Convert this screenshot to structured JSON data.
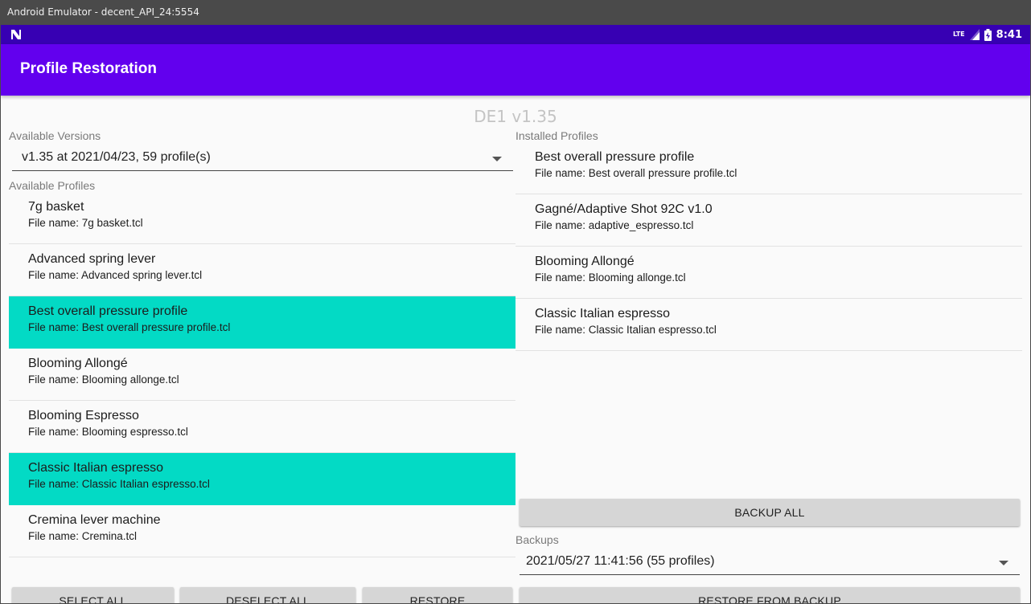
{
  "window": {
    "title": "Android Emulator - decent_API_24:5554"
  },
  "statusbar": {
    "network": "LTE",
    "time": "8:41",
    "icons": [
      "n-notification-icon",
      "signal-icon",
      "battery-charging-icon"
    ]
  },
  "appbar": {
    "title": "Profile Restoration"
  },
  "header": {
    "version": "DE1 v1.35"
  },
  "left": {
    "versions_label": "Available Versions",
    "version_selected": "v1.35 at 2021/04/23, 59 profile(s)",
    "profiles_label": "Available Profiles",
    "profiles": [
      {
        "name": "7g basket",
        "file": "File name: 7g basket.tcl",
        "selected": false
      },
      {
        "name": "Advanced spring lever",
        "file": "File name: Advanced spring lever.tcl",
        "selected": false
      },
      {
        "name": "Best overall pressure profile",
        "file": "File name: Best overall pressure profile.tcl",
        "selected": true
      },
      {
        "name": "Blooming Allongé",
        "file": "File name: Blooming allonge.tcl",
        "selected": false
      },
      {
        "name": "Blooming Espresso",
        "file": "File name: Blooming espresso.tcl",
        "selected": false
      },
      {
        "name": "Classic Italian espresso",
        "file": "File name: Classic Italian espresso.tcl",
        "selected": true
      },
      {
        "name": "Cremina lever machine",
        "file": "File name: Cremina.tcl",
        "selected": false
      }
    ],
    "buttons": {
      "select_all": "SELECT ALL",
      "deselect_all": "DESELECT ALL",
      "restore": "RESTORE"
    }
  },
  "right": {
    "installed_label": "Installed Profiles",
    "installed": [
      {
        "name": "Best overall pressure profile",
        "file": "File name: Best overall pressure profile.tcl"
      },
      {
        "name": "Gagné/Adaptive Shot 92C v1.0",
        "file": "File name: adaptive_espresso.tcl"
      },
      {
        "name": "Blooming Allongé",
        "file": "File name: Blooming allonge.tcl"
      },
      {
        "name": "Classic Italian espresso",
        "file": "File name: Classic Italian espresso.tcl"
      }
    ],
    "backup_all": "BACKUP ALL",
    "backups_label": "Backups",
    "backup_selected": "2021/05/27 11:41:56 (55 profiles)",
    "restore_from_backup": "RESTORE FROM BACKUP"
  },
  "colors": {
    "statusbar": "#3700b3",
    "appbar": "#6200ee",
    "selected": "#03dac5",
    "button": "#d6d6d6"
  }
}
